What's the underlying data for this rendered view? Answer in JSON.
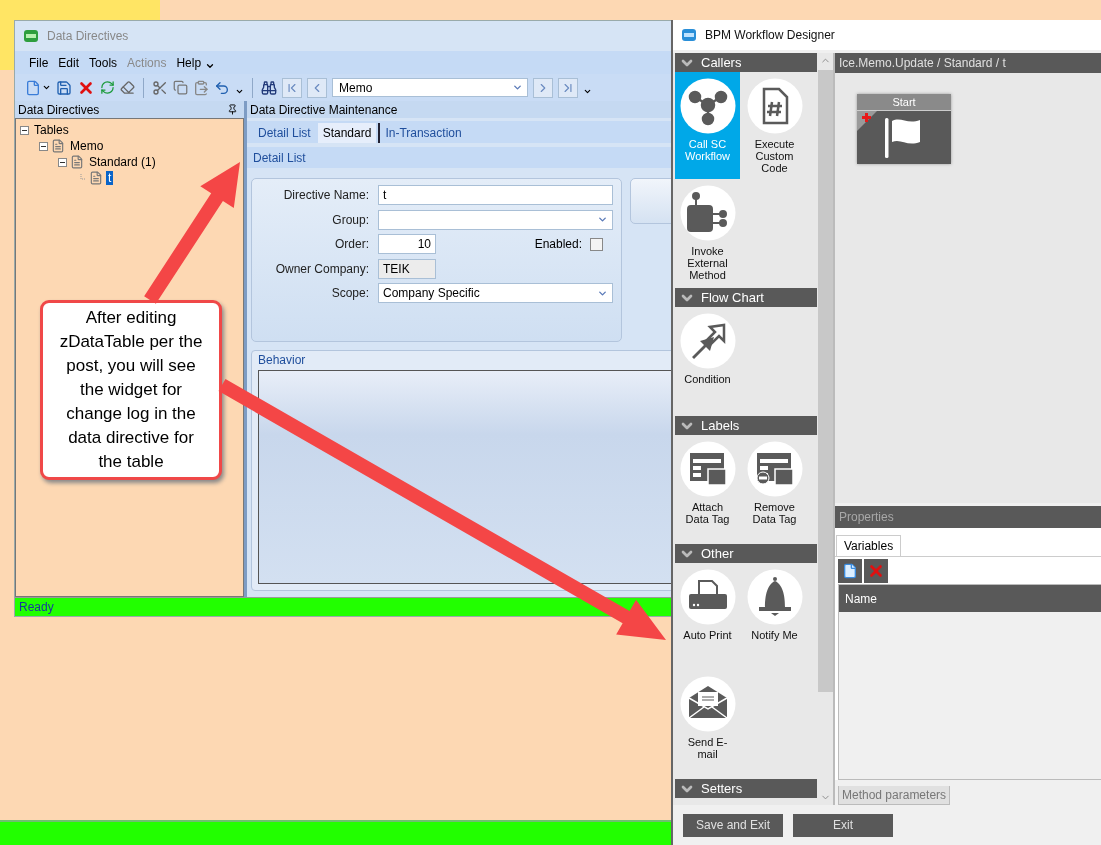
{
  "data_directives_window": {
    "title": "Data Directives",
    "menu": [
      {
        "label": "File",
        "disabled": false
      },
      {
        "label": "Edit",
        "disabled": false
      },
      {
        "label": "Tools",
        "disabled": false
      },
      {
        "label": "Actions",
        "disabled": true
      },
      {
        "label": "Help",
        "disabled": false
      }
    ],
    "toolbar": {
      "record_field": "Memo"
    },
    "tree_panel": {
      "title": "Data Directives",
      "tree": [
        {
          "label": "Tables",
          "expanded": true,
          "selected": false,
          "children": [
            {
              "label": "Memo",
              "expanded": true,
              "selected": false,
              "children": [
                {
                  "label": "Standard (1)",
                  "expanded": true,
                  "selected": false,
                  "children": [
                    {
                      "label": "t",
                      "selected": true
                    }
                  ]
                }
              ]
            }
          ]
        }
      ]
    },
    "maintenance_panel": {
      "title": "Data Directive Maintenance",
      "tabs": [
        {
          "label": "Detail List",
          "selected": false
        },
        {
          "label": "Standard",
          "selected": true
        },
        {
          "label": "In-Transaction",
          "selected": false
        }
      ],
      "subtab": "Detail List",
      "fields": [
        {
          "label": "Directive Name:",
          "kind": "text",
          "value": "t"
        },
        {
          "label": "Group:",
          "kind": "combo"
        },
        {
          "label": "Order:",
          "kind": "number",
          "value": "10",
          "checkbox": {
            "label": "Enabled:",
            "checked": false
          }
        },
        {
          "label": "Owner Company:",
          "kind": "readonly",
          "value": "TEIK"
        },
        {
          "label": "Scope:",
          "kind": "combo",
          "value": "Company Specific"
        }
      ],
      "behavior_title": "Behavior"
    },
    "status": "Ready"
  },
  "workflow_designer": {
    "title": "BPM Workflow Designer",
    "palette": [
      {
        "title": "Callers",
        "expanded": true,
        "items": [
          {
            "label": "Call SC Workflow",
            "kind": "workflow",
            "selected": true
          },
          {
            "label": "Execute Custom Code",
            "kind": "code",
            "selected": false
          },
          {
            "label": "Invoke External Method",
            "kind": "external",
            "selected": false
          }
        ]
      },
      {
        "title": "Flow Chart",
        "expanded": true,
        "items": [
          {
            "label": "Condition",
            "kind": "condition",
            "selected": false
          }
        ]
      },
      {
        "title": "Labels",
        "expanded": true,
        "items": [
          {
            "label": "Attach Data Tag",
            "kind": "attach",
            "selected": false
          },
          {
            "label": "Remove Data Tag",
            "kind": "remove",
            "selected": false
          }
        ]
      },
      {
        "title": "Other",
        "expanded": true,
        "items": [
          {
            "label": "Auto Print",
            "kind": "print",
            "selected": false
          },
          {
            "label": "Notify Me",
            "kind": "notify",
            "selected": false
          },
          {
            "label": "Send E-mail",
            "kind": "email",
            "selected": false
          }
        ]
      },
      {
        "title": "Setters",
        "expanded": true
      }
    ],
    "canvas": {
      "breadcrumb": "Ice.Memo.Update / Standard / t",
      "nodes": [
        {
          "title": "Start"
        }
      ]
    },
    "properties": {
      "title": "Properties",
      "tabs": [
        {
          "label": "Variables",
          "selected": true
        }
      ],
      "columns": [
        "Name"
      ],
      "bottom_tabs": [
        {
          "label": "Method parameters",
          "selected": false
        }
      ]
    },
    "buttons": [
      "Save and Exit",
      "Exit"
    ]
  },
  "callout": {
    "text": "After editing zDataTable per the post, you will see the widget for change log in the data directive for the table"
  }
}
